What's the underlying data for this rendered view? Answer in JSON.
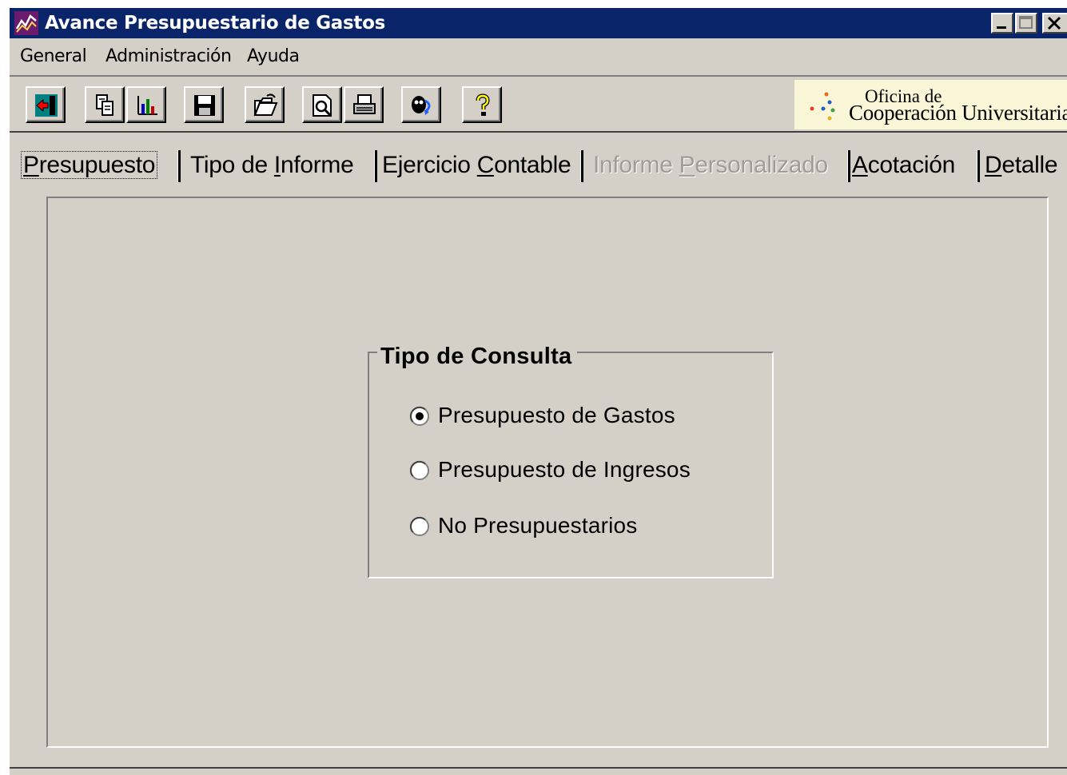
{
  "window": {
    "title": "Avance Presupuestario de Gastos",
    "accent_color": "#0a246a",
    "background_color": "#d4d0c8"
  },
  "menu": {
    "items": [
      {
        "label": "General"
      },
      {
        "label": "Administración"
      },
      {
        "label": "Ayuda"
      }
    ]
  },
  "toolbar": {
    "buttons": [
      {
        "icon": "exit-icon"
      },
      {
        "icon": "copy-icon"
      },
      {
        "icon": "chart-icon"
      },
      {
        "icon": "save-icon"
      },
      {
        "icon": "open-folder-icon"
      },
      {
        "icon": "print-preview-icon"
      },
      {
        "icon": "print-icon"
      },
      {
        "icon": "query-icon"
      },
      {
        "icon": "help-icon"
      }
    ],
    "logo": {
      "line1": "Oficina de",
      "line2": "Cooperación Universitaria"
    }
  },
  "tabs": [
    {
      "pre": "",
      "mnemonic": "P",
      "post": "resupuesto",
      "active": true,
      "disabled": false
    },
    {
      "pre": "Tipo de ",
      "mnemonic": "I",
      "post": "nforme",
      "active": false,
      "disabled": false
    },
    {
      "pre": "Ejercicio ",
      "mnemonic": "C",
      "post": "ontable",
      "active": false,
      "disabled": false
    },
    {
      "pre": "Informe ",
      "mnemonic": "P",
      "post": "ersonalizado",
      "active": false,
      "disabled": true
    },
    {
      "pre": "",
      "mnemonic": "A",
      "post": "cotación",
      "active": false,
      "disabled": false
    },
    {
      "pre": "",
      "mnemonic": "D",
      "post": "etalle",
      "active": false,
      "disabled": false
    }
  ],
  "group": {
    "title": "Tipo de Consulta",
    "options": [
      {
        "label": "Presupuesto de Gastos",
        "selected": true
      },
      {
        "label": "Presupuesto de Ingresos",
        "selected": false
      },
      {
        "label": "No Presupuestarios",
        "selected": false
      }
    ]
  }
}
